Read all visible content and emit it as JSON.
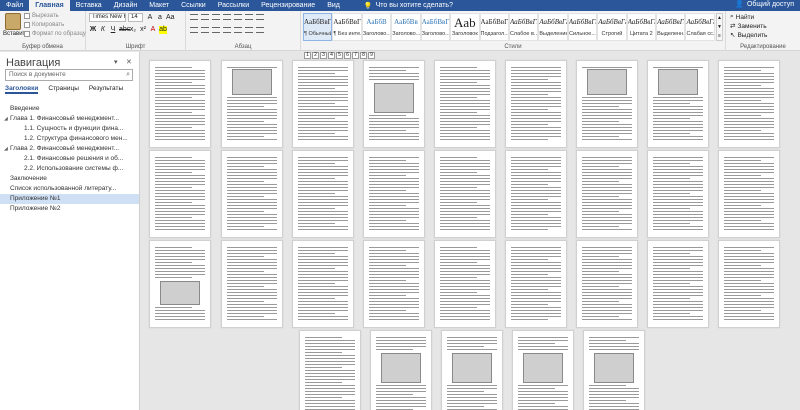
{
  "tabs": [
    "Файл",
    "Главная",
    "Вставка",
    "Дизайн",
    "Макет",
    "Ссылки",
    "Рассылки",
    "Рецензирование",
    "Вид"
  ],
  "active_tab": "Главная",
  "tell_me": "Что вы хотите сделать?",
  "share": "Общий доступ",
  "clipboard": {
    "paste": "Вставить",
    "cut": "Вырезать",
    "copy": "Копировать",
    "format_painter": "Формат по образцу",
    "label": "Буфер обмена"
  },
  "font": {
    "name": "Times New R",
    "size": "14",
    "label": "Шрифт"
  },
  "paragraph": {
    "label": "Абзац"
  },
  "styles": {
    "label": "Стили",
    "items": [
      {
        "sample": "АаБбВвГг,",
        "name": "¶ Обычный"
      },
      {
        "sample": "АаБбВвГг,",
        "name": "¶ Без инте..."
      },
      {
        "sample": "АаБбВ",
        "name": "Заголово..."
      },
      {
        "sample": "АаБбВв",
        "name": "Заголово..."
      },
      {
        "sample": "АаБбВвГ",
        "name": "Заголово..."
      },
      {
        "sample": "Aab",
        "name": "Заголовок"
      },
      {
        "sample": "АаБбВвГ",
        "name": "Подзагол..."
      },
      {
        "sample": "АаБбВвГг",
        "name": "Слабое в..."
      },
      {
        "sample": "АаБбВвГг",
        "name": "Выделение"
      },
      {
        "sample": "АаБбВвГг",
        "name": "Сильное..."
      },
      {
        "sample": "АаБбВвГг",
        "name": "Строгий"
      },
      {
        "sample": "АаБбВвГг",
        "name": "Цитата 2"
      },
      {
        "sample": "АаБбВвГг",
        "name": "Выделенн..."
      },
      {
        "sample": "АаБбВвГг",
        "name": "Слабая сс..."
      }
    ]
  },
  "editing": {
    "find": "Найти",
    "replace": "Заменить",
    "select": "Выделить",
    "label": "Редактирование"
  },
  "navigation": {
    "title": "Навигация",
    "search_placeholder": "Поиск в документе",
    "tabs": [
      "Заголовки",
      "Страницы",
      "Результаты"
    ],
    "items": [
      {
        "level": 1,
        "text": "Введение"
      },
      {
        "level": 1,
        "text": "Глава 1. Финансовый менеджмент..."
      },
      {
        "level": 2,
        "text": "1.1. Сущность и функции фина..."
      },
      {
        "level": 2,
        "text": "1.2. Структура финансового мен..."
      },
      {
        "level": 1,
        "text": "Глава 2. Финансовый менеджмент..."
      },
      {
        "level": 2,
        "text": "2.1. Финансовые решения и об..."
      },
      {
        "level": 2,
        "text": "2.2. Использование системы ф..."
      },
      {
        "level": 1,
        "text": "Заключение"
      },
      {
        "level": 1,
        "text": "Список использованной литерату..."
      },
      {
        "level": 1,
        "text": "Приложение №1"
      },
      {
        "level": 1,
        "text": "Приложение №2"
      }
    ],
    "selected": "Приложение №1"
  },
  "ruler_numbers": [
    "1",
    "2",
    "3",
    "4",
    "5",
    "6",
    "7",
    "8",
    "9"
  ]
}
